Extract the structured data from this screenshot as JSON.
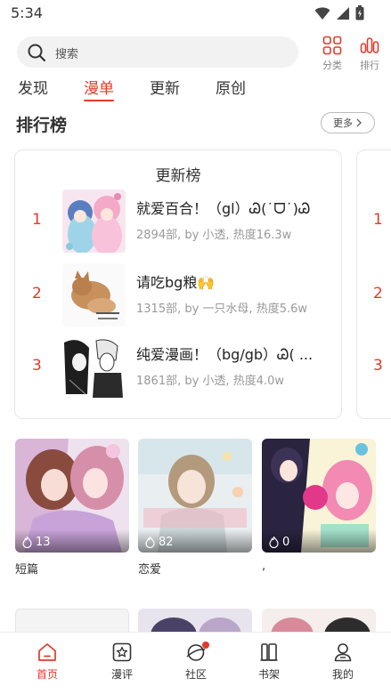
{
  "status_bar": {
    "time": "5:34"
  },
  "search": {
    "placeholder": "搜索"
  },
  "top_actions": [
    {
      "label": "分类",
      "icon": "category-grid-icon"
    },
    {
      "label": "排行",
      "icon": "ranking-bars-icon"
    }
  ],
  "tabs": [
    {
      "label": "发现",
      "active": false
    },
    {
      "label": "漫单",
      "active": true
    },
    {
      "label": "更新",
      "active": false
    },
    {
      "label": "原创",
      "active": false
    }
  ],
  "section": {
    "title": "排行榜",
    "more_label": "更多"
  },
  "rank_card": {
    "title": "更新榜",
    "items": [
      {
        "rank": "1",
        "name": "就爱百合！（gl）Ꮚ(˙ᗜ˙)Ꮚ",
        "meta": "2894部, by 小透, 热度16.3w"
      },
      {
        "rank": "2",
        "name": "请吃bg粮🙌",
        "meta": "1315部, by 一只水母, 热度5.6w"
      },
      {
        "rank": "3",
        "name": "纯爱漫画！（bg/gb）Ꮚ( ...",
        "meta": "1861部, by 小透, 热度4.0w"
      }
    ]
  },
  "rank_card_peek": {
    "ranks": [
      "1",
      "2",
      "3"
    ]
  },
  "grid": [
    {
      "likes": "13",
      "caption": "短篇"
    },
    {
      "likes": "82",
      "caption": "恋爱"
    },
    {
      "likes": "0",
      "caption": ","
    }
  ],
  "bottom_nav": [
    {
      "label": "首页",
      "icon": "home-icon",
      "active": true
    },
    {
      "label": "漫评",
      "icon": "star-review-icon",
      "active": false
    },
    {
      "label": "社区",
      "icon": "planet-icon",
      "active": false
    },
    {
      "label": "书架",
      "icon": "bookshelf-icon",
      "active": false
    },
    {
      "label": "我的",
      "icon": "profile-icon",
      "active": false
    }
  ],
  "colors": {
    "accent": "#e23a2c",
    "muted": "#999999"
  }
}
